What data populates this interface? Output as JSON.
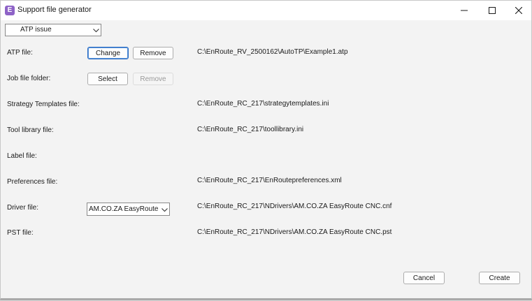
{
  "window": {
    "title": "Support file generator",
    "icon_letter": "E",
    "controls": [
      "minimize",
      "maximize",
      "close"
    ]
  },
  "issue_select": {
    "selected": "ATP issue"
  },
  "rows": {
    "atp": {
      "label": "ATP file:",
      "change_label": "Change",
      "remove_label": "Remove",
      "path": "C:\\EnRoute_RV_2500162\\AutoTP\\Example1.atp"
    },
    "job": {
      "label": "Job file folder:",
      "select_label": "Select",
      "remove_label": "Remove",
      "remove_enabled": false
    },
    "strategy": {
      "label": "Strategy Templates file:",
      "path": "C:\\EnRoute_RC_217\\strategytemplates.ini"
    },
    "tool": {
      "label": "Tool library file:",
      "path": "C:\\EnRoute_RC_217\\toollibrary.ini"
    },
    "labelfile": {
      "label": "Label file:",
      "path": ""
    },
    "preferences": {
      "label": "Preferences file:",
      "path": "C:\\EnRoute_RC_217\\EnRoutepreferences.xml"
    },
    "driver": {
      "label": "Driver file:",
      "selected": "AM.CO.ZA EasyRoute CNC",
      "path": "C:\\EnRoute_RC_217\\NDrivers\\AM.CO.ZA EasyRoute CNC.cnf"
    },
    "pst": {
      "label": "PST file:",
      "path": "C:\\EnRoute_RC_217\\NDrivers\\AM.CO.ZA EasyRoute CNC.pst"
    }
  },
  "footer": {
    "cancel_label": "Cancel",
    "create_label": "Create"
  }
}
